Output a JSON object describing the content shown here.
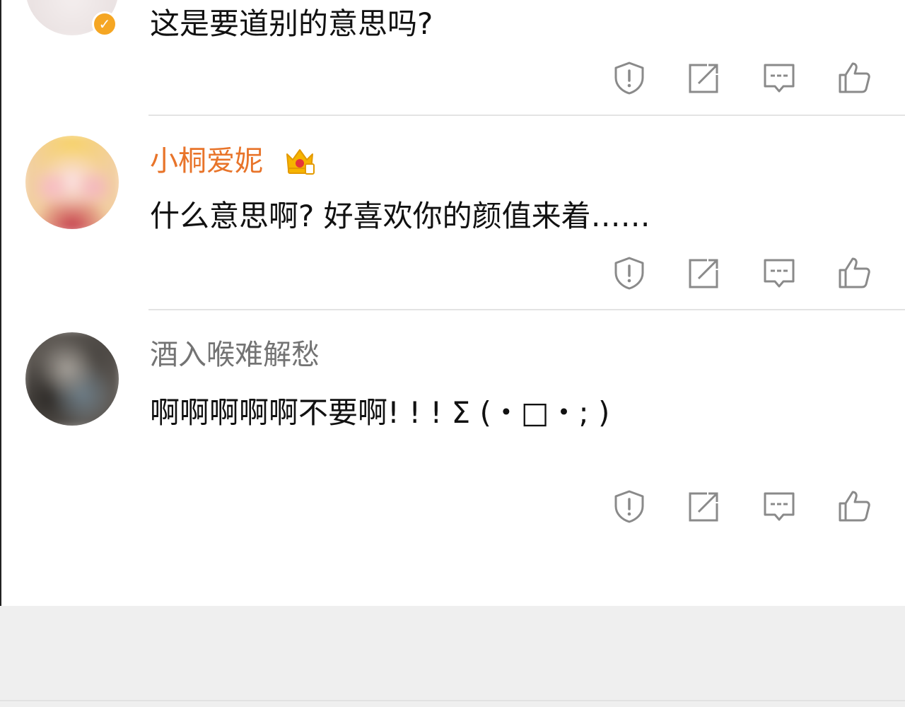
{
  "comments": [
    {
      "username": "",
      "text": "这是要道别的意思吗?",
      "avatar_icon": "avatar-blurred",
      "verified_icon": "verified-check-icon"
    },
    {
      "username": "小桐爱妮",
      "username_color": "#e8742a",
      "badge_icon": "crown-vip-icon",
      "text": "什么意思啊? 好喜欢你的颜值来着……",
      "avatar_icon": "avatar-blurred"
    },
    {
      "username": "酒入喉难解愁",
      "username_color": "#737373",
      "text": "啊啊啊啊啊不要啊! ! ! Σ (・□・; )",
      "avatar_icon": "avatar-blurred"
    }
  ],
  "actions": [
    "report-icon",
    "repost-icon",
    "comment-icon",
    "like-icon"
  ],
  "colors": {
    "accent": "#f5a623",
    "icon_gray": "#8a8a8a",
    "divider": "#e3e3e3",
    "footer_bg": "#efefef"
  }
}
